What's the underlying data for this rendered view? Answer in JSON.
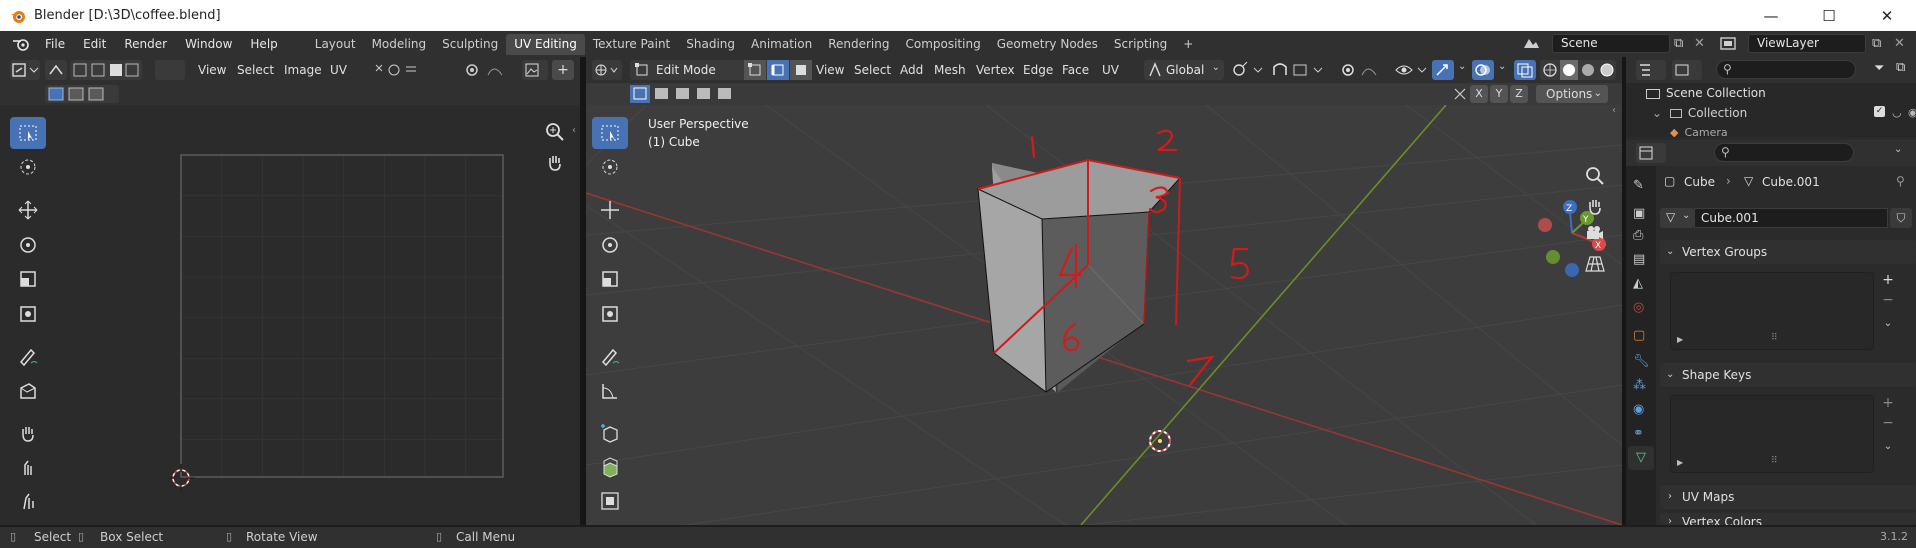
{
  "window": {
    "title": "Blender [D:\\3D\\coffee.blend]",
    "controls": [
      "—",
      "☐",
      "✕"
    ]
  },
  "top_menu": [
    "File",
    "Edit",
    "Render",
    "Window",
    "Help"
  ],
  "workspace_tabs": [
    {
      "label": "Layout",
      "active": false
    },
    {
      "label": "Modeling",
      "active": false
    },
    {
      "label": "Sculpting",
      "active": false
    },
    {
      "label": "UV Editing",
      "active": true
    },
    {
      "label": "Texture Paint",
      "active": false
    },
    {
      "label": "Shading",
      "active": false
    },
    {
      "label": "Animation",
      "active": false
    },
    {
      "label": "Rendering",
      "active": false
    },
    {
      "label": "Compositing",
      "active": false
    },
    {
      "label": "Geometry Nodes",
      "active": false
    },
    {
      "label": "Scripting",
      "active": false
    },
    {
      "label": "+",
      "active": false
    }
  ],
  "scene": {
    "label": "Scene",
    "view_layer": "ViewLayer"
  },
  "uv_editor": {
    "menus": [
      "View",
      "Select",
      "Image",
      "UV"
    ]
  },
  "viewport": {
    "mode": "Edit Mode",
    "menus": [
      "View",
      "Select",
      "Add",
      "Mesh",
      "Vertex",
      "Edge",
      "Face",
      "UV"
    ],
    "orientation": "Global",
    "axes": [
      "X",
      "Y",
      "Z"
    ],
    "options_label": "Options",
    "overlay_title": "User Perspective",
    "overlay_object": "(1) Cube",
    "annotations": [
      "1",
      "2",
      "3",
      "4",
      "5",
      "6",
      "7"
    ],
    "gizmo_axes": {
      "x": "X",
      "y": "Y",
      "z": "Z"
    },
    "colors": {
      "x_axis": "#b83a3a",
      "y_axis": "#6b9a2a",
      "z_axis": "#3a6fc4",
      "edit_edge": "#d01a1a"
    }
  },
  "outliner": {
    "items": [
      "Scene Collection",
      "Collection",
      "Camera"
    ]
  },
  "properties": {
    "breadcrumb_object": "Cube",
    "breadcrumb_mesh": "Cube.001",
    "mesh_name": "Cube.001",
    "panels": [
      "Vertex Groups",
      "Shape Keys",
      "UV Maps",
      "Vertex Colors"
    ]
  },
  "status": {
    "select": "Select",
    "box_select": "Box Select",
    "rotate_view": "Rotate View",
    "call_menu": "Call Menu",
    "version": "3.1.2"
  }
}
